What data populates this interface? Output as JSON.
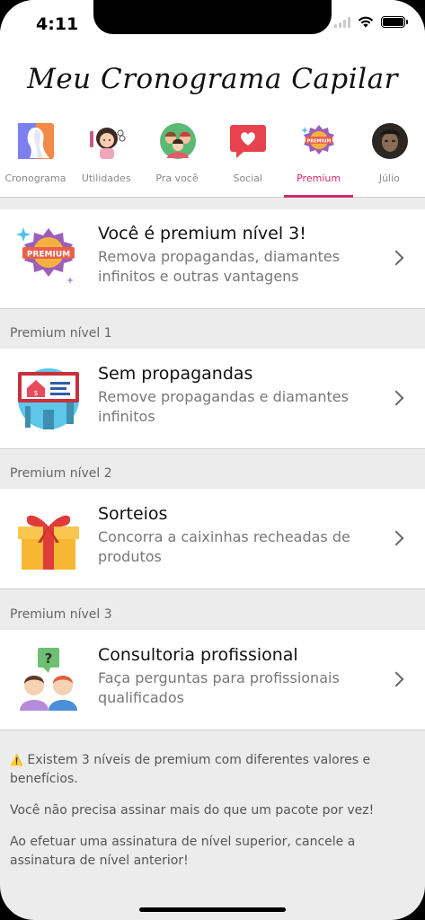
{
  "status": {
    "time": "4:11"
  },
  "header": {
    "title": "Meu Cronograma Capilar"
  },
  "tabs": [
    {
      "label": "Cronograma",
      "icon": "hair-profile-icon"
    },
    {
      "label": "Utilidades",
      "icon": "hair-tools-icon"
    },
    {
      "label": "Pra você",
      "icon": "friends-icon"
    },
    {
      "label": "Social",
      "icon": "heart-chat-icon"
    },
    {
      "label": "Premium",
      "icon": "premium-badge-icon",
      "active": true
    },
    {
      "label": "Júlio",
      "icon": "user-avatar"
    }
  ],
  "premium_card": {
    "title": "Você é premium nível 3!",
    "description": "Remova propagandas, diamantes infinitos e outras vantagens",
    "badge_text": "PREMIUM"
  },
  "sections": [
    {
      "label": "Premium nível 1",
      "title": "Sem propagandas",
      "description": "Remove propagandas e diamantes infinitos"
    },
    {
      "label": "Premium nível 2",
      "title": "Sorteios",
      "description": "Concorra a caixinhas recheadas de produtos"
    },
    {
      "label": "Premium nível 3",
      "title": "Consultoria profissional",
      "description": "Faça perguntas para profissionais qualificados"
    }
  ],
  "footer": {
    "warning_icon": "⚠️",
    "line1": "Existem 3 níveis de premium com diferentes valores e benefícios.",
    "line2": "Você não precisa assinar mais do que um pacote por vez!",
    "line3": "Ao efetuar uma assinatura de nível superior, cancele a assinatura de nível anterior!"
  },
  "colors": {
    "accent": "#d2286d",
    "background": "#ececec"
  }
}
